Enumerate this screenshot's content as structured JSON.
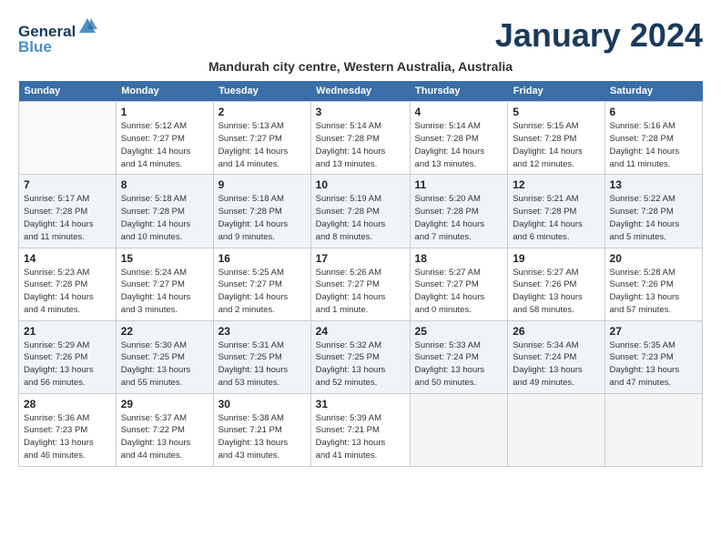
{
  "header": {
    "logo_line1": "General",
    "logo_line2": "Blue",
    "title": "January 2024",
    "subtitle": "Mandurah city centre, Western Australia, Australia"
  },
  "days_of_week": [
    "Sunday",
    "Monday",
    "Tuesday",
    "Wednesday",
    "Thursday",
    "Friday",
    "Saturday"
  ],
  "weeks": [
    [
      {
        "num": "",
        "info": ""
      },
      {
        "num": "1",
        "info": "Sunrise: 5:12 AM\nSunset: 7:27 PM\nDaylight: 14 hours\nand 14 minutes."
      },
      {
        "num": "2",
        "info": "Sunrise: 5:13 AM\nSunset: 7:27 PM\nDaylight: 14 hours\nand 14 minutes."
      },
      {
        "num": "3",
        "info": "Sunrise: 5:14 AM\nSunset: 7:28 PM\nDaylight: 14 hours\nand 13 minutes."
      },
      {
        "num": "4",
        "info": "Sunrise: 5:14 AM\nSunset: 7:28 PM\nDaylight: 14 hours\nand 13 minutes."
      },
      {
        "num": "5",
        "info": "Sunrise: 5:15 AM\nSunset: 7:28 PM\nDaylight: 14 hours\nand 12 minutes."
      },
      {
        "num": "6",
        "info": "Sunrise: 5:16 AM\nSunset: 7:28 PM\nDaylight: 14 hours\nand 11 minutes."
      }
    ],
    [
      {
        "num": "7",
        "info": "Sunrise: 5:17 AM\nSunset: 7:28 PM\nDaylight: 14 hours\nand 11 minutes."
      },
      {
        "num": "8",
        "info": "Sunrise: 5:18 AM\nSunset: 7:28 PM\nDaylight: 14 hours\nand 10 minutes."
      },
      {
        "num": "9",
        "info": "Sunrise: 5:18 AM\nSunset: 7:28 PM\nDaylight: 14 hours\nand 9 minutes."
      },
      {
        "num": "10",
        "info": "Sunrise: 5:19 AM\nSunset: 7:28 PM\nDaylight: 14 hours\nand 8 minutes."
      },
      {
        "num": "11",
        "info": "Sunrise: 5:20 AM\nSunset: 7:28 PM\nDaylight: 14 hours\nand 7 minutes."
      },
      {
        "num": "12",
        "info": "Sunrise: 5:21 AM\nSunset: 7:28 PM\nDaylight: 14 hours\nand 6 minutes."
      },
      {
        "num": "13",
        "info": "Sunrise: 5:22 AM\nSunset: 7:28 PM\nDaylight: 14 hours\nand 5 minutes."
      }
    ],
    [
      {
        "num": "14",
        "info": "Sunrise: 5:23 AM\nSunset: 7:28 PM\nDaylight: 14 hours\nand 4 minutes."
      },
      {
        "num": "15",
        "info": "Sunrise: 5:24 AM\nSunset: 7:27 PM\nDaylight: 14 hours\nand 3 minutes."
      },
      {
        "num": "16",
        "info": "Sunrise: 5:25 AM\nSunset: 7:27 PM\nDaylight: 14 hours\nand 2 minutes."
      },
      {
        "num": "17",
        "info": "Sunrise: 5:26 AM\nSunset: 7:27 PM\nDaylight: 14 hours\nand 1 minute."
      },
      {
        "num": "18",
        "info": "Sunrise: 5:27 AM\nSunset: 7:27 PM\nDaylight: 14 hours\nand 0 minutes."
      },
      {
        "num": "19",
        "info": "Sunrise: 5:27 AM\nSunset: 7:26 PM\nDaylight: 13 hours\nand 58 minutes."
      },
      {
        "num": "20",
        "info": "Sunrise: 5:28 AM\nSunset: 7:26 PM\nDaylight: 13 hours\nand 57 minutes."
      }
    ],
    [
      {
        "num": "21",
        "info": "Sunrise: 5:29 AM\nSunset: 7:26 PM\nDaylight: 13 hours\nand 56 minutes."
      },
      {
        "num": "22",
        "info": "Sunrise: 5:30 AM\nSunset: 7:25 PM\nDaylight: 13 hours\nand 55 minutes."
      },
      {
        "num": "23",
        "info": "Sunrise: 5:31 AM\nSunset: 7:25 PM\nDaylight: 13 hours\nand 53 minutes."
      },
      {
        "num": "24",
        "info": "Sunrise: 5:32 AM\nSunset: 7:25 PM\nDaylight: 13 hours\nand 52 minutes."
      },
      {
        "num": "25",
        "info": "Sunrise: 5:33 AM\nSunset: 7:24 PM\nDaylight: 13 hours\nand 50 minutes."
      },
      {
        "num": "26",
        "info": "Sunrise: 5:34 AM\nSunset: 7:24 PM\nDaylight: 13 hours\nand 49 minutes."
      },
      {
        "num": "27",
        "info": "Sunrise: 5:35 AM\nSunset: 7:23 PM\nDaylight: 13 hours\nand 47 minutes."
      }
    ],
    [
      {
        "num": "28",
        "info": "Sunrise: 5:36 AM\nSunset: 7:23 PM\nDaylight: 13 hours\nand 46 minutes."
      },
      {
        "num": "29",
        "info": "Sunrise: 5:37 AM\nSunset: 7:22 PM\nDaylight: 13 hours\nand 44 minutes."
      },
      {
        "num": "30",
        "info": "Sunrise: 5:38 AM\nSunset: 7:21 PM\nDaylight: 13 hours\nand 43 minutes."
      },
      {
        "num": "31",
        "info": "Sunrise: 5:39 AM\nSunset: 7:21 PM\nDaylight: 13 hours\nand 41 minutes."
      },
      {
        "num": "",
        "info": ""
      },
      {
        "num": "",
        "info": ""
      },
      {
        "num": "",
        "info": ""
      }
    ]
  ]
}
